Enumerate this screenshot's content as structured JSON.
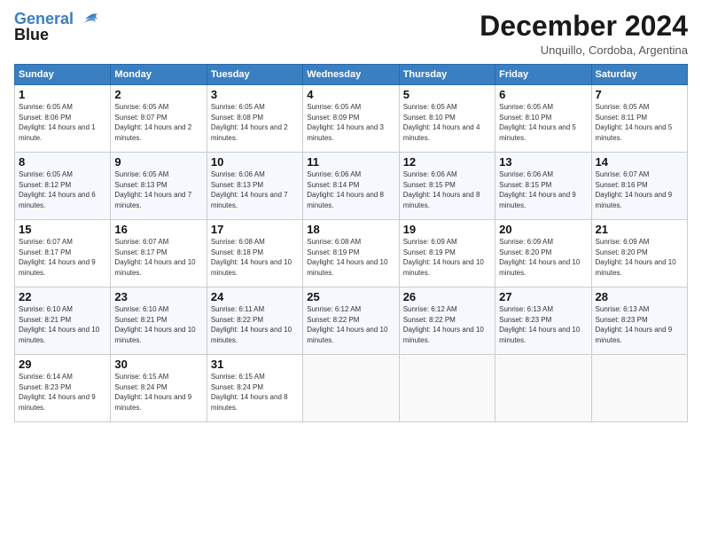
{
  "logo": {
    "line1": "General",
    "line2": "Blue"
  },
  "title": "December 2024",
  "subtitle": "Unquillo, Cordoba, Argentina",
  "days_of_week": [
    "Sunday",
    "Monday",
    "Tuesday",
    "Wednesday",
    "Thursday",
    "Friday",
    "Saturday"
  ],
  "weeks": [
    [
      {
        "day": "1",
        "sunrise": "6:05 AM",
        "sunset": "8:06 PM",
        "daylight": "14 hours and 1 minute."
      },
      {
        "day": "2",
        "sunrise": "6:05 AM",
        "sunset": "8:07 PM",
        "daylight": "14 hours and 2 minutes."
      },
      {
        "day": "3",
        "sunrise": "6:05 AM",
        "sunset": "8:08 PM",
        "daylight": "14 hours and 2 minutes."
      },
      {
        "day": "4",
        "sunrise": "6:05 AM",
        "sunset": "8:09 PM",
        "daylight": "14 hours and 3 minutes."
      },
      {
        "day": "5",
        "sunrise": "6:05 AM",
        "sunset": "8:10 PM",
        "daylight": "14 hours and 4 minutes."
      },
      {
        "day": "6",
        "sunrise": "6:05 AM",
        "sunset": "8:10 PM",
        "daylight": "14 hours and 5 minutes."
      },
      {
        "day": "7",
        "sunrise": "6:05 AM",
        "sunset": "8:11 PM",
        "daylight": "14 hours and 5 minutes."
      }
    ],
    [
      {
        "day": "8",
        "sunrise": "6:05 AM",
        "sunset": "8:12 PM",
        "daylight": "14 hours and 6 minutes."
      },
      {
        "day": "9",
        "sunrise": "6:05 AM",
        "sunset": "8:13 PM",
        "daylight": "14 hours and 7 minutes."
      },
      {
        "day": "10",
        "sunrise": "6:06 AM",
        "sunset": "8:13 PM",
        "daylight": "14 hours and 7 minutes."
      },
      {
        "day": "11",
        "sunrise": "6:06 AM",
        "sunset": "8:14 PM",
        "daylight": "14 hours and 8 minutes."
      },
      {
        "day": "12",
        "sunrise": "6:06 AM",
        "sunset": "8:15 PM",
        "daylight": "14 hours and 8 minutes."
      },
      {
        "day": "13",
        "sunrise": "6:06 AM",
        "sunset": "8:15 PM",
        "daylight": "14 hours and 9 minutes."
      },
      {
        "day": "14",
        "sunrise": "6:07 AM",
        "sunset": "8:16 PM",
        "daylight": "14 hours and 9 minutes."
      }
    ],
    [
      {
        "day": "15",
        "sunrise": "6:07 AM",
        "sunset": "8:17 PM",
        "daylight": "14 hours and 9 minutes."
      },
      {
        "day": "16",
        "sunrise": "6:07 AM",
        "sunset": "8:17 PM",
        "daylight": "14 hours and 10 minutes."
      },
      {
        "day": "17",
        "sunrise": "6:08 AM",
        "sunset": "8:18 PM",
        "daylight": "14 hours and 10 minutes."
      },
      {
        "day": "18",
        "sunrise": "6:08 AM",
        "sunset": "8:19 PM",
        "daylight": "14 hours and 10 minutes."
      },
      {
        "day": "19",
        "sunrise": "6:09 AM",
        "sunset": "8:19 PM",
        "daylight": "14 hours and 10 minutes."
      },
      {
        "day": "20",
        "sunrise": "6:09 AM",
        "sunset": "8:20 PM",
        "daylight": "14 hours and 10 minutes."
      },
      {
        "day": "21",
        "sunrise": "6:09 AM",
        "sunset": "8:20 PM",
        "daylight": "14 hours and 10 minutes."
      }
    ],
    [
      {
        "day": "22",
        "sunrise": "6:10 AM",
        "sunset": "8:21 PM",
        "daylight": "14 hours and 10 minutes."
      },
      {
        "day": "23",
        "sunrise": "6:10 AM",
        "sunset": "8:21 PM",
        "daylight": "14 hours and 10 minutes."
      },
      {
        "day": "24",
        "sunrise": "6:11 AM",
        "sunset": "8:22 PM",
        "daylight": "14 hours and 10 minutes."
      },
      {
        "day": "25",
        "sunrise": "6:12 AM",
        "sunset": "8:22 PM",
        "daylight": "14 hours and 10 minutes."
      },
      {
        "day": "26",
        "sunrise": "6:12 AM",
        "sunset": "8:22 PM",
        "daylight": "14 hours and 10 minutes."
      },
      {
        "day": "27",
        "sunrise": "6:13 AM",
        "sunset": "8:23 PM",
        "daylight": "14 hours and 10 minutes."
      },
      {
        "day": "28",
        "sunrise": "6:13 AM",
        "sunset": "8:23 PM",
        "daylight": "14 hours and 9 minutes."
      }
    ],
    [
      {
        "day": "29",
        "sunrise": "6:14 AM",
        "sunset": "8:23 PM",
        "daylight": "14 hours and 9 minutes."
      },
      {
        "day": "30",
        "sunrise": "6:15 AM",
        "sunset": "8:24 PM",
        "daylight": "14 hours and 9 minutes."
      },
      {
        "day": "31",
        "sunrise": "6:15 AM",
        "sunset": "8:24 PM",
        "daylight": "14 hours and 8 minutes."
      },
      null,
      null,
      null,
      null
    ]
  ]
}
